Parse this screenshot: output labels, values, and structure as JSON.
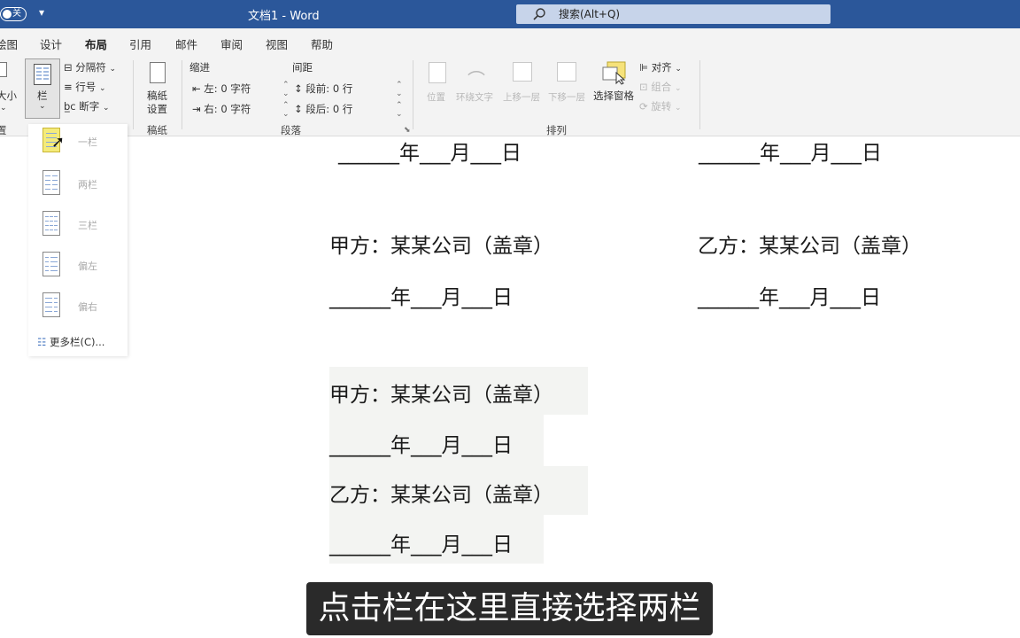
{
  "titlebar": {
    "autosave": "关",
    "qat": "▾",
    "doc_title": "文档1  -  Word",
    "search_placeholder": "搜索(Alt+Q)"
  },
  "tabs": [
    "绘图",
    "设计",
    "布局",
    "引用",
    "邮件",
    "审阅",
    "视图",
    "帮助"
  ],
  "active_tab": "布局",
  "ribbon": {
    "size_label": "大小",
    "columns_label": "栏",
    "page_setup_group": "置",
    "breaks": "分隔符",
    "line_numbers": "行号",
    "hyphenation": "断字",
    "draft_paper": [
      "稿纸",
      "设置"
    ],
    "draft_group": "稿纸",
    "indent_title": "缩进",
    "spacing_title": "间距",
    "indent_left_label": "左:",
    "indent_left_value": "0 字符",
    "indent_right_label": "右:",
    "indent_right_value": "0 字符",
    "space_before_label": "段前:",
    "space_before_value": "0 行",
    "space_after_label": "段后:",
    "space_after_value": "0 行",
    "paragraph_group": "段落",
    "position": "位置",
    "wrap_text": "环绕文字",
    "bring_forward": "上移一层",
    "send_backward": "下移一层",
    "selection_pane": "选择窗格",
    "align": "对齐",
    "group": "组合",
    "rotate": "旋转",
    "arrange_group": "排列"
  },
  "columns_menu": {
    "items": [
      "一栏",
      "两栏",
      "三栏",
      "偏左",
      "偏右"
    ],
    "more": "更多栏(C)..."
  },
  "document": {
    "date_line": "______年___月___日",
    "party_a": "甲方：某某公司（盖章）",
    "party_b": "乙方：某某公司（盖章）"
  },
  "subtitle": "点击栏在这里直接选择两栏"
}
